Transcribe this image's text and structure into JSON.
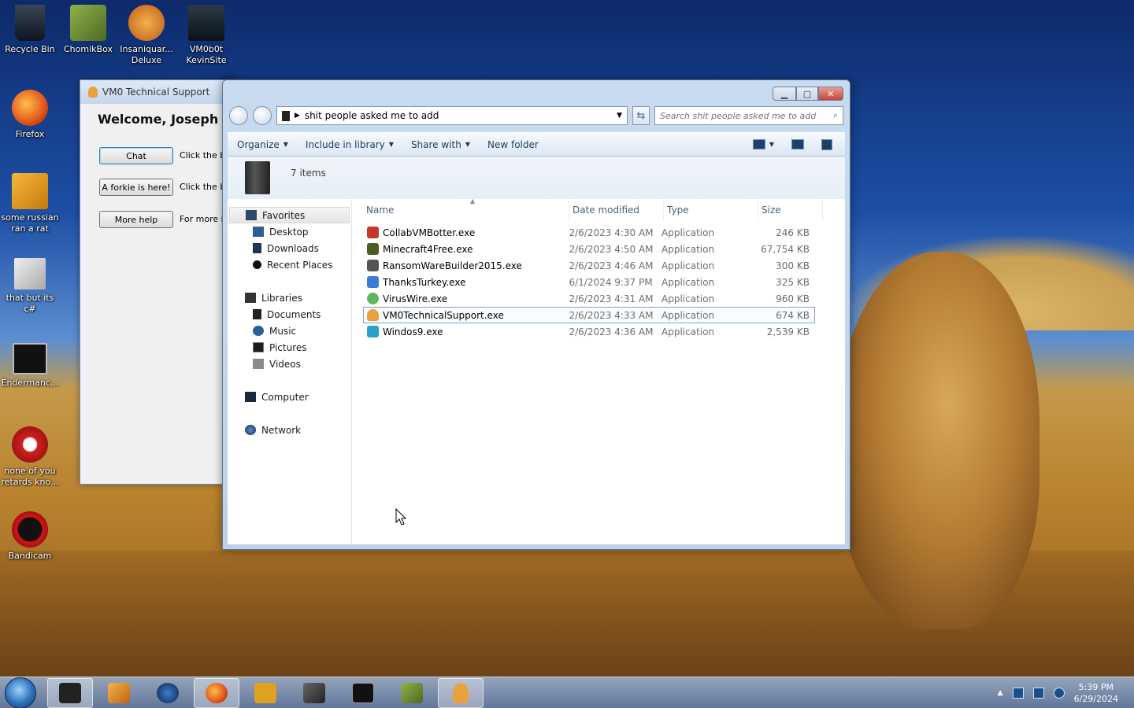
{
  "desktop_icons": [
    {
      "label": "Recycle Bin",
      "icon": "recycle-bin-icon",
      "color": "#1a2233"
    },
    {
      "label": "ChomikBox",
      "icon": "chomikbox-icon",
      "color": "#6b8e3a"
    },
    {
      "label": "Insaniquar... Deluxe",
      "icon": "insaniquarium-icon",
      "color": "#d9822b"
    },
    {
      "label": "VM0b0t KevinSite",
      "icon": "vm0b0t-icon",
      "color": "#1c2630"
    },
    {
      "label": "Firefox",
      "icon": "firefox-icon",
      "color": "#e66a1f"
    },
    {
      "label": "some russian ran a rat",
      "icon": "app-icon",
      "color": "#e0a020"
    },
    {
      "label": "that but its c#",
      "icon": "windows-stack-icon",
      "color": "#d0d0d0"
    },
    {
      "label": "Endermanc...",
      "icon": "terminal-icon",
      "color": "#222222"
    },
    {
      "label": "none of you retards kno...",
      "icon": "red-app-icon",
      "color": "#d02020"
    },
    {
      "label": "Bandicam",
      "icon": "bandicam-icon",
      "color": "#cc1111"
    }
  ],
  "support_window": {
    "title": "VM0 Technical Support",
    "welcome": "Welcome, Joseph B",
    "buttons": [
      {
        "label": "Chat",
        "hint": "Click the bu"
      },
      {
        "label": "A forkie is here!",
        "hint": "Click the bu"
      },
      {
        "label": "More help",
        "hint": "For more he"
      }
    ]
  },
  "explorer": {
    "path": "shit people asked me to add",
    "search_placeholder": "Search shit people asked me to add",
    "toolbar": {
      "organize": "Organize",
      "include_in_library": "Include in library",
      "share_with": "Share with",
      "new_folder": "New folder"
    },
    "item_count": "7 items",
    "nav": {
      "favorites": "Favorites",
      "desktop": "Desktop",
      "downloads": "Downloads",
      "recent_places": "Recent Places",
      "libraries": "Libraries",
      "documents": "Documents",
      "music": "Music",
      "pictures": "Pictures",
      "videos": "Videos",
      "computer": "Computer",
      "network": "Network"
    },
    "columns": {
      "name": "Name",
      "date": "Date modified",
      "type": "Type",
      "size": "Size"
    },
    "files": [
      {
        "name": "CollabVMBotter.exe",
        "date": "2/6/2023 4:30 AM",
        "type": "Application",
        "size": "246 KB",
        "color": "#c0392b"
      },
      {
        "name": "Minecraft4Free.exe",
        "date": "2/6/2023 4:50 AM",
        "type": "Application",
        "size": "67,754 KB",
        "color": "#4a5d23"
      },
      {
        "name": "RansomWareBuilder2015.exe",
        "date": "2/6/2023 4:46 AM",
        "type": "Application",
        "size": "300 KB",
        "color": "#555555"
      },
      {
        "name": "ThanksTurkey.exe",
        "date": "6/1/2024 9:37 PM",
        "type": "Application",
        "size": "325 KB",
        "color": "#3a7bd5"
      },
      {
        "name": "VirusWire.exe",
        "date": "2/6/2023 4:31 AM",
        "type": "Application",
        "size": "960 KB",
        "color": "#5cb85c"
      },
      {
        "name": "VM0TechnicalSupport.exe",
        "date": "2/6/2023 4:33 AM",
        "type": "Application",
        "size": "674 KB",
        "color": "#e8a23c"
      },
      {
        "name": "Windos9.exe",
        "date": "2/6/2023 4:36 AM",
        "type": "Application",
        "size": "2,539 KB",
        "color": "#2aa1c9"
      }
    ]
  },
  "taskbar": {
    "apps": [
      {
        "icon": "explorer-icon",
        "color": "#222222",
        "active": true
      },
      {
        "icon": "media-player-icon",
        "color": "#e08a1e",
        "active": false
      },
      {
        "icon": "globe-icon",
        "color": "#1a4f8a",
        "active": false
      },
      {
        "icon": "firefox-icon",
        "color": "#e66a1f",
        "active": true
      },
      {
        "icon": "de-app-icon",
        "color": "#e0a020",
        "active": false
      },
      {
        "icon": "windows-stack-icon",
        "color": "#444444",
        "active": false
      },
      {
        "icon": "terminal-icon",
        "color": "#111111",
        "active": false
      },
      {
        "icon": "chomikbox-icon",
        "color": "#6b8e3a",
        "active": false
      },
      {
        "icon": "support-icon",
        "color": "#e8a23c",
        "active": true
      }
    ],
    "time": "5:39 PM",
    "date": "6/29/2024"
  }
}
